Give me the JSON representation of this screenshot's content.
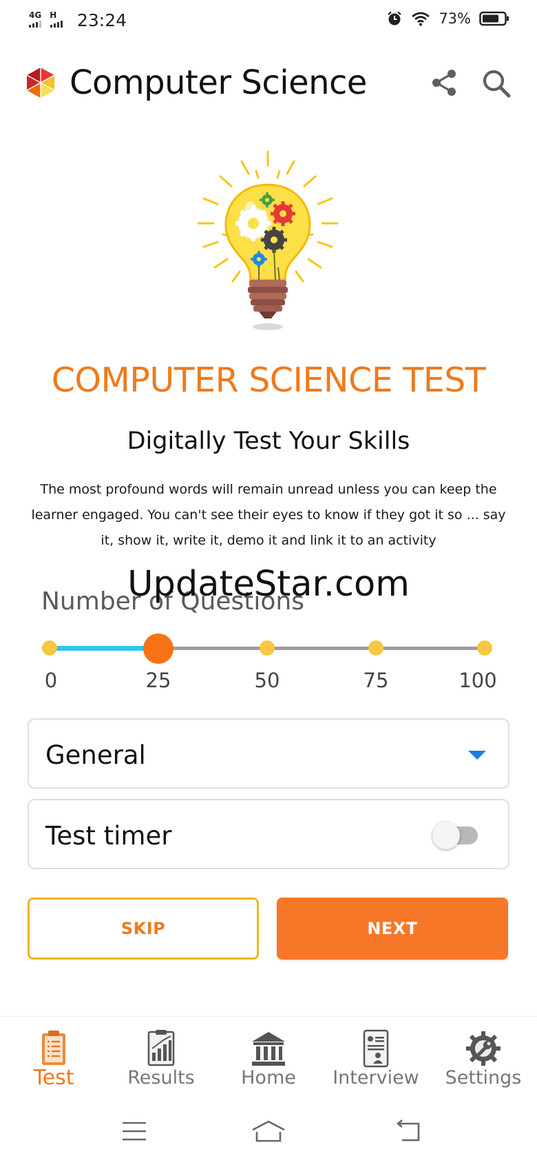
{
  "status_bar": {
    "network_1": "4G",
    "network_2": "H",
    "time": "23:24",
    "battery": "73%",
    "icons": [
      "alarm-icon",
      "wifi-icon",
      "battery-icon"
    ]
  },
  "app_bar": {
    "title": "Computer Science",
    "icons": [
      "app-logo-icon",
      "share-icon",
      "search-icon"
    ]
  },
  "hero": {
    "title": "COMPUTER SCIENCE TEST",
    "subtitle": "Digitally Test Your Skills",
    "description": "The most profound words will remain unread unless you can keep the learner engaged. You can't see their eyes to know if they got it so ... say it, show it, write it, demo it and link it to an activity",
    "icon": "lightbulb-gears-icon"
  },
  "watermark": "UpdateStar.com",
  "questions": {
    "label": "Number of Questions",
    "ticks": [
      "0",
      "25",
      "50",
      "75",
      "100"
    ],
    "value": 25,
    "min": 0,
    "max": 100
  },
  "category": {
    "selected": "General"
  },
  "timer": {
    "label": "Test timer",
    "enabled": false
  },
  "buttons": {
    "skip": "SKIP",
    "next": "NEXT"
  },
  "bottom_nav": {
    "items": [
      {
        "label": "Test",
        "icon": "clipboard-checklist-icon",
        "active": true
      },
      {
        "label": "Results",
        "icon": "bar-chart-report-icon",
        "active": false
      },
      {
        "label": "Home",
        "icon": "building-columns-icon",
        "active": false
      },
      {
        "label": "Interview",
        "icon": "interview-document-icon",
        "active": false
      },
      {
        "label": "Settings",
        "icon": "gear-wrench-icon",
        "active": false
      }
    ]
  },
  "colors": {
    "accent": "#ef7a1c",
    "slider_fill": "#2fc6ec",
    "slider_dot": "#f8c741",
    "caret": "#1a7fe0",
    "skip_border": "#f2b51e"
  }
}
